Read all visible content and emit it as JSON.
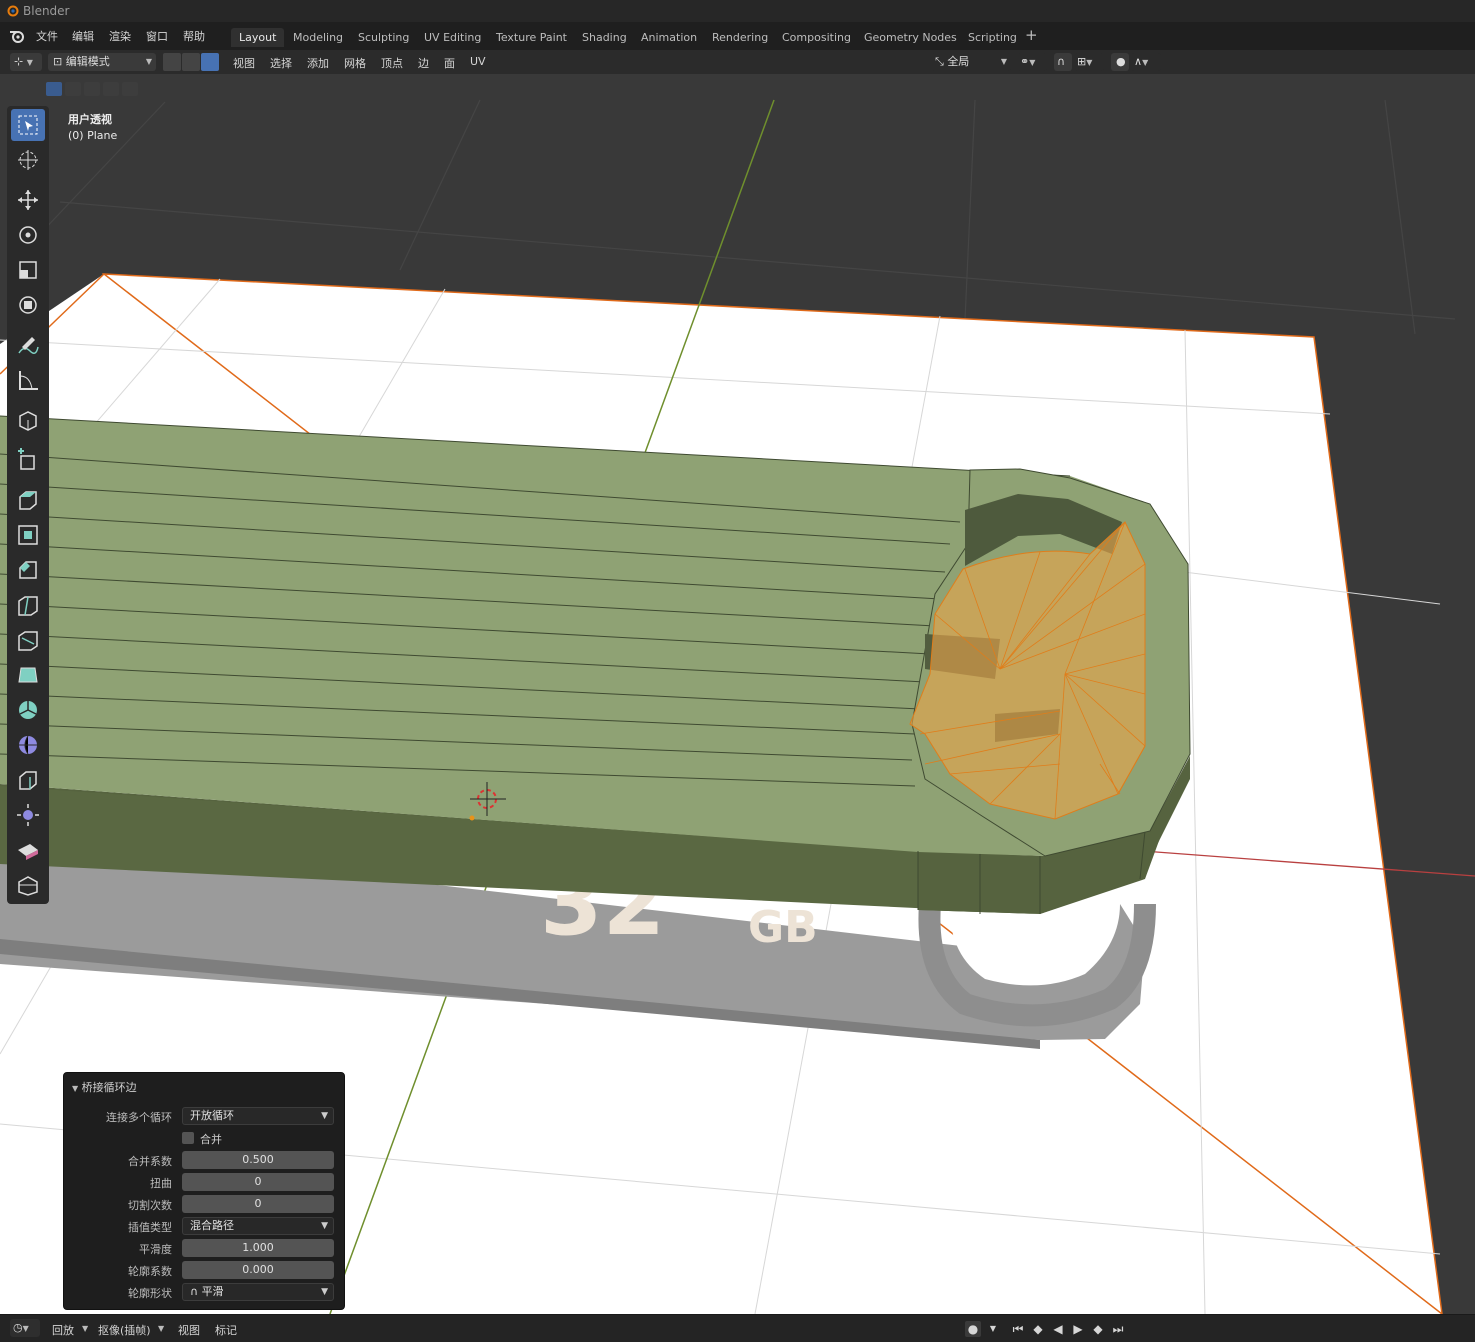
{
  "app": {
    "title": "Blender"
  },
  "menu": [
    "文件",
    "编辑",
    "渲染",
    "窗口",
    "帮助"
  ],
  "workspaces": [
    "Layout",
    "Modeling",
    "Sculpting",
    "UV Editing",
    "Texture Paint",
    "Shading",
    "Animation",
    "Rendering",
    "Compositing",
    "Geometry Nodes",
    "Scripting"
  ],
  "active_workspace": "Layout",
  "header": {
    "mode": "编辑模式",
    "menus": [
      "视图",
      "选择",
      "添加",
      "网格",
      "顶点",
      "边",
      "面",
      "UV"
    ],
    "orientation": "全局"
  },
  "viewport": {
    "view_name": "用户透视",
    "object_name": "(0) Plane",
    "background_text": "32",
    "background_unit": "GB"
  },
  "operator_panel": {
    "title": "桥接循环边",
    "rows": [
      {
        "label": "连接多个循环",
        "type": "dropdown",
        "value": "开放循环"
      },
      {
        "label": "合并",
        "type": "checkbox",
        "value": ""
      },
      {
        "label": "合并系数",
        "type": "number",
        "value": "0.500"
      },
      {
        "label": "扭曲",
        "type": "number",
        "value": "0"
      },
      {
        "label": "切割次数",
        "type": "number",
        "value": "0"
      },
      {
        "label": "插值类型",
        "type": "dropdown",
        "value": "混合路径"
      },
      {
        "label": "平滑度",
        "type": "number",
        "value": "1.000"
      },
      {
        "label": "轮廓系数",
        "type": "number",
        "value": "0.000"
      },
      {
        "label": "轮廓形状",
        "type": "dropdown",
        "value": "平滑"
      }
    ]
  },
  "timeline": {
    "items": [
      "回放",
      "抠像(插帧)",
      "视图",
      "标记"
    ]
  },
  "colors": {
    "accent": "#4772b3",
    "mesh_face": "#8fa274",
    "selection": "#e8a44a",
    "object_outline": "#e06a1a"
  }
}
